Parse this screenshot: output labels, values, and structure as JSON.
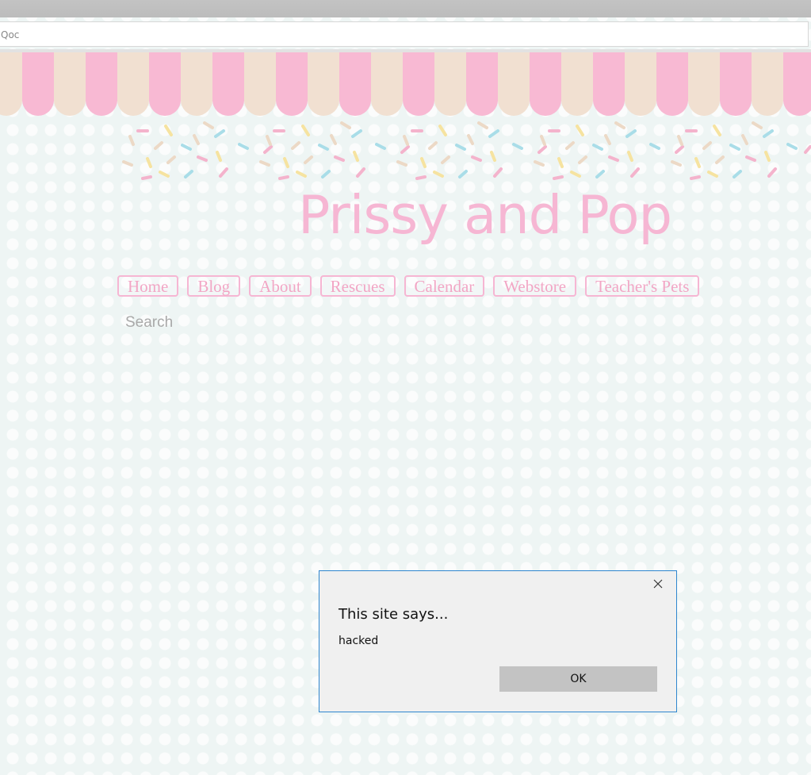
{
  "browser": {
    "address_text": "Qoc"
  },
  "site": {
    "title": "Prissy and Pop",
    "colors": {
      "title_pink": "#f6b6d3",
      "awning_pink": "#f8b9d3",
      "awning_cream": "#f1e0d1",
      "background": "#eef5f4"
    }
  },
  "nav": {
    "items": [
      {
        "label": "Home"
      },
      {
        "label": "Blog"
      },
      {
        "label": "About"
      },
      {
        "label": "Rescues"
      },
      {
        "label": "Calendar"
      },
      {
        "label": "Webstore"
      },
      {
        "label": "Teacher's Pets"
      }
    ]
  },
  "search": {
    "placeholder": "Search",
    "value": ""
  },
  "dialog": {
    "title": "This site says...",
    "message": "hacked",
    "ok_label": "OK",
    "close_icon": "close-icon",
    "border_color": "#2e86cf"
  }
}
